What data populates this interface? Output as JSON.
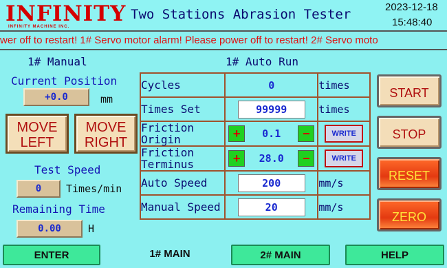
{
  "header": {
    "logo_text": "INFINITY",
    "logo_sub": "INFINITY MACHINE INC.",
    "title": "Two Stations Abrasion Tester",
    "date": "2023-12-18",
    "time": "15:48:40"
  },
  "ticker": {
    "text": "wer off to restart! 1# Servo motor alarm! Please  power off to restart! 2# Servo moto"
  },
  "manual": {
    "title": "1# Manual",
    "current_position_label": "Current Position",
    "current_position_value": "+0.0",
    "current_position_unit": "mm",
    "move_left_line1": "MOVE",
    "move_left_line2": "LEFT",
    "move_right_line1": "MOVE",
    "move_right_line2": "RIGHT",
    "test_speed_label": "Test Speed",
    "test_speed_value": "0",
    "test_speed_unit": "Times/min",
    "remaining_time_label": "Remaining Time",
    "remaining_time_value": "0.00",
    "remaining_time_unit": "H"
  },
  "auto": {
    "title": "1# Auto Run",
    "cycles_label": "Cycles",
    "cycles_value": "0",
    "cycles_unit": "times",
    "times_set_label": "Times Set",
    "times_set_value": "99999",
    "times_set_unit": "times",
    "friction_origin_label1": "Friction",
    "friction_origin_label2": "Origin",
    "friction_origin_value": "0.1",
    "friction_terminus_label1": "Friction",
    "friction_terminus_label2": "Terminus",
    "friction_terminus_value": "28.0",
    "plus": "+",
    "minus": "−",
    "write_label": "WRITE",
    "auto_speed_label": "Auto Speed",
    "auto_speed_value": "200",
    "auto_speed_unit": "mm/s",
    "manual_speed_label": "Manual Speed",
    "manual_speed_value": "20",
    "manual_speed_unit": "mm/s"
  },
  "actions": {
    "start": "START",
    "stop": "STOP",
    "reset": "RESET",
    "zero": "ZERO"
  },
  "bottom": {
    "enter": "ENTER",
    "main1": "1# MAIN",
    "main2": "2# MAIN",
    "help": "HELP"
  },
  "colors": {
    "background": "#8cf0f0",
    "alarm_text": "#e01010",
    "value_blue": "#1a2ad0",
    "accent_red": "#e33a10",
    "nav_green": "#3ee89a"
  }
}
